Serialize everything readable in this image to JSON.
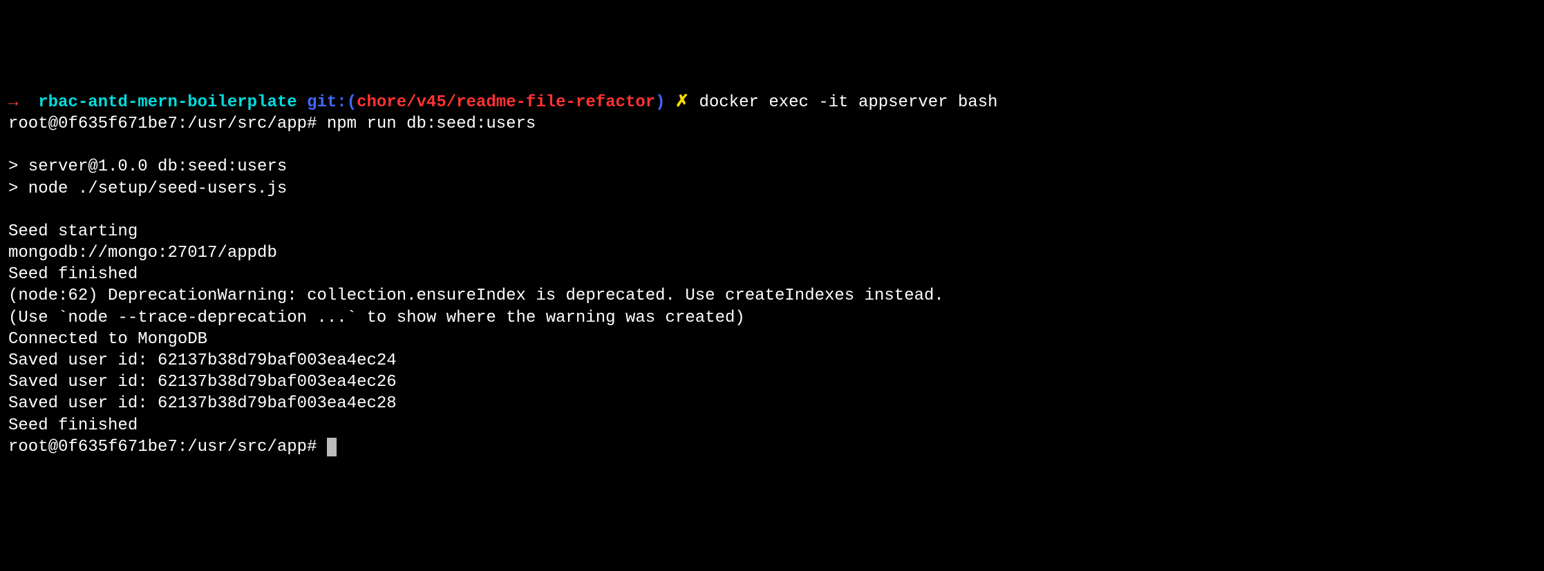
{
  "prompt1": {
    "arrow": "→ ",
    "repo": " rbac-antd-mern-boilerplate ",
    "git": "git:(",
    "branch": "chore/v45/readme-file-refactor",
    "closeParen": ") ",
    "xmark": "✗ ",
    "command": "docker exec -it appserver bash"
  },
  "prompt2": {
    "prefix": "root@0f635f671be7:/usr/src/app# ",
    "command": "npm run db:seed:users"
  },
  "output": {
    "blank1": "",
    "l1": "> server@1.0.0 db:seed:users",
    "l2": "> node ./setup/seed-users.js",
    "blank2": "",
    "l3": "Seed starting",
    "l4": "mongodb://mongo:27017/appdb",
    "l5": "Seed finished",
    "l6": "(node:62) DeprecationWarning: collection.ensureIndex is deprecated. Use createIndexes instead.",
    "l7": "(Use `node --trace-deprecation ...` to show where the warning was created)",
    "l8": "Connected to MongoDB",
    "l9": "Saved user id: 62137b38d79baf003ea4ec24",
    "l10": "Saved user id: 62137b38d79baf003ea4ec26",
    "l11": "Saved user id: 62137b38d79baf003ea4ec28",
    "l12": "Seed finished"
  },
  "prompt3": {
    "prefix": "root@0f635f671be7:/usr/src/app# "
  }
}
